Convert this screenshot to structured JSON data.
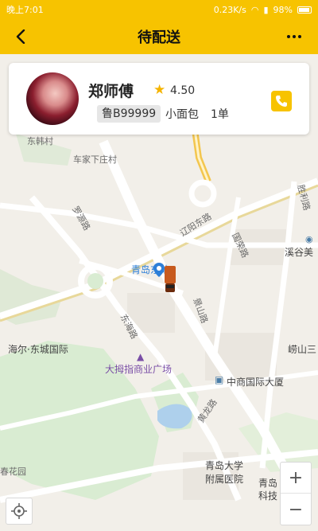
{
  "status_bar": {
    "time": "晚上7:01",
    "network": "0.23K/s",
    "battery": "98%"
  },
  "nav": {
    "title": "待配送"
  },
  "driver": {
    "name": "郑师傅",
    "rating": "4.50",
    "plate": "鲁B99999",
    "vehicle": "小面包",
    "orders": "1单"
  },
  "map": {
    "labels": {
      "dongting": "东韩村",
      "chejiaxia": "车家下庄村",
      "luoyuan": "罗源路",
      "liaoyang": "辽阳东路",
      "qingdao_east": "青岛东站",
      "qingdao_station_road": "青岛      东站",
      "haier": "海尔·东城国际",
      "dayao": "大拇指商业广场",
      "zhongshang": "中商国际大厦",
      "xigu": "溪谷美",
      "laoshan": "崂山三",
      "qingda": "青岛大学",
      "fushu": "附属医院",
      "qingdao_tech": "青岛",
      "tech2": "科技",
      "chunhua": "春花园",
      "guorong": "国荣路",
      "shengli": "胜利路",
      "jingwu": "景山路",
      "dongfeng": "东海路",
      "huang": "黄龙路"
    }
  },
  "zoom": {
    "in": "+",
    "out": "−"
  }
}
